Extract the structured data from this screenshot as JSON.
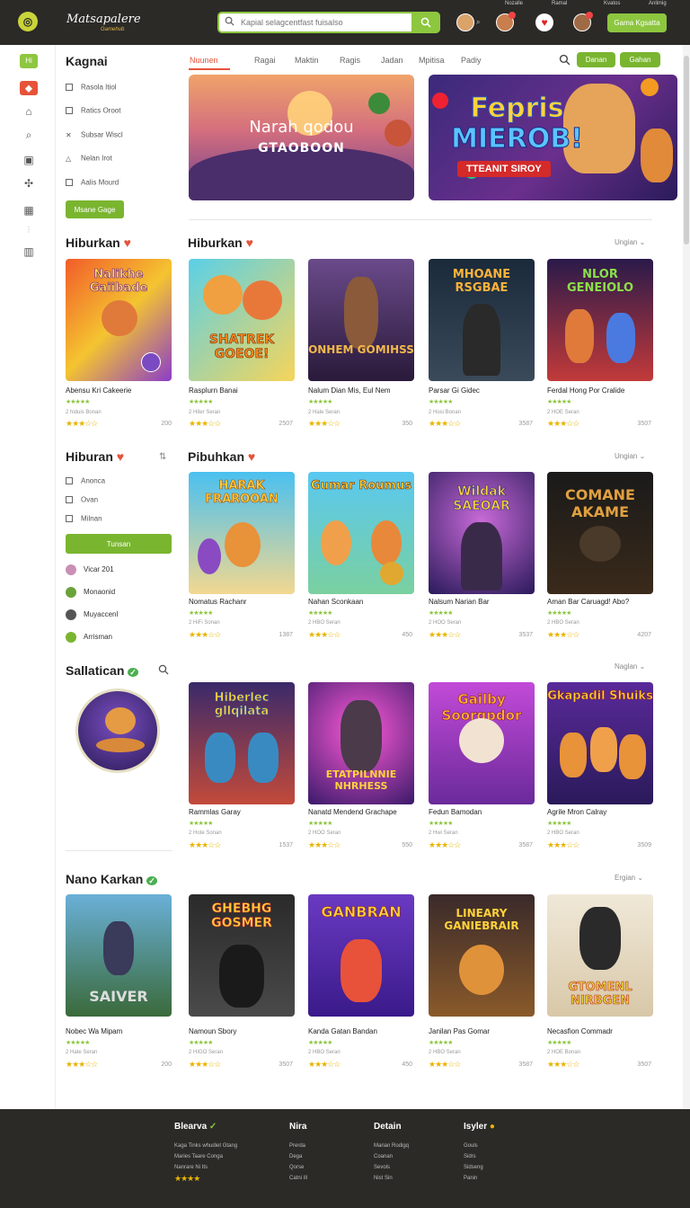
{
  "header": {
    "brand": "Matsapalere",
    "brand_sub": "Gamehub",
    "search_placeholder": "Kapial selagcentfast fuisalso",
    "top_strip": [
      "Nozalle",
      "Ramal",
      "Kvatos",
      "Anlimig"
    ],
    "cta": "Gama Kgsatta"
  },
  "rail": {
    "top_badge": "Hi"
  },
  "sidebar": {
    "title": "Kagnai",
    "filters": [
      "Rasola Itiol",
      "Ratics Oroot",
      "Subsar Wiscl",
      "Nelan Irot",
      "Aalis Mourd"
    ],
    "filters_button": "Msane Gage",
    "section2_title": "Hiburan",
    "section2_filters": [
      "Anonca",
      "Ovan",
      "Milnan"
    ],
    "section2_button": "Tunsan",
    "users": [
      "Vicar 201",
      "Monaonid",
      "Muyaccenl",
      "Arrisman"
    ],
    "section3_title": "Sallatican",
    "section4_title": "Nano Karkan"
  },
  "nav": {
    "tabs": [
      "Nuunen",
      "Ragai",
      "Maktin",
      "Ragis",
      "Jadan",
      "Mpitisa",
      "Padiy"
    ],
    "btn1": "Danan",
    "btn2": "Gahan"
  },
  "banners": {
    "left_title": "Narah qodou",
    "left_sub": "GTAOBOON",
    "right_title1": "Fepris",
    "right_title2": "MIEROB!",
    "right_sub": "TTEANIT SIROY"
  },
  "sections": [
    {
      "title": "Hiburkan",
      "more": "Ungian",
      "cards": [
        {
          "name": "Abensu Kri Cakeerie",
          "meta": "2 hiduis Bonan",
          "count": "200",
          "art": "Nalikhe Gaiibade"
        },
        {
          "name": "Rasplurn Banai",
          "meta": "2 Hiter Seran",
          "count": "2507",
          "art": "SHATREK GOEOE!"
        },
        {
          "name": "Nalum Dian Mis, Eul Nem",
          "meta": "2 Hale Seran",
          "count": "350",
          "art": "ONHEM GOMIHSS"
        },
        {
          "name": "Parsar Gi Gidec",
          "meta": "2 Hosi Bonan",
          "count": "3587",
          "art": "MHOANE RSGBAE"
        },
        {
          "name": "Ferdal Hong Por Cralide",
          "meta": "2 HOE Seran",
          "count": "3507",
          "art": "NLOR GENEIOLO"
        }
      ]
    },
    {
      "title": "Pibuhkan",
      "more": "Ungian",
      "cards": [
        {
          "name": "Nomatus Rachanr",
          "meta": "2 HiFi Sonan",
          "count": "1387",
          "art": "HARAK FRAROOAN"
        },
        {
          "name": "Nahan Sconkaan",
          "meta": "2 HBO Seran",
          "count": "450",
          "art": "Gumar Roumus"
        },
        {
          "name": "Nalsum Narian Bar",
          "meta": "2 HOO Seran",
          "count": "3537",
          "art": "Wildak SAEOAR"
        },
        {
          "name": "Aman Bar Caruagd! Abo?",
          "meta": "2 HBO Seran",
          "count": "4207",
          "art": "COMANE AKAME"
        }
      ]
    },
    {
      "title": "",
      "more": "Naglan",
      "cards": [
        {
          "name": "Rammlas Garay",
          "meta": "2 Hote Sonan",
          "count": "1537",
          "art": "Hiberlec gllqilata"
        },
        {
          "name": "Nanatd Mendend Grachape",
          "meta": "2 HOO Seran",
          "count": "550",
          "art": "ETATPILNNIE NHRHESS"
        },
        {
          "name": "Fedun Bamodan",
          "meta": "2 Hwi Seran",
          "count": "3587",
          "art": "Gailby Soorgpdor"
        },
        {
          "name": "Agrile Mron Calray",
          "meta": "2 HBO Seran",
          "count": "3509",
          "art": "Gkapadil Shuiks"
        }
      ]
    },
    {
      "title": "",
      "more": "Ergian",
      "cards": [
        {
          "name": "Nobec Wa Mipam",
          "meta": "2 Hate Seran",
          "count": "200",
          "art": "SAIVER"
        },
        {
          "name": "Namoun Sbory",
          "meta": "2 HIGO Seran",
          "count": "3507",
          "art": "GHEBHG GOSMER"
        },
        {
          "name": "Kanda Gatan Bandan",
          "meta": "2 HBO Seran",
          "count": "450",
          "art": "GANBRAN"
        },
        {
          "name": "Janilan Pas Gomar",
          "meta": "2 HBO Seran",
          "count": "3587",
          "art": "LINEARY GANIEBRAIR"
        },
        {
          "name": "Necasfion Commadr",
          "meta": "2 HOE Bonan",
          "count": "3507",
          "art": "GTOMENL NIRBGEN"
        }
      ]
    }
  ],
  "footer": {
    "col1_title": "Blearva",
    "col1_links": [
      "Kaga Tinks whudiet Gtang",
      "Maries Taare Conga",
      "Nanrare Ni Its"
    ],
    "col2_title": "Nira",
    "col2_links": [
      "Prerda",
      "Dega",
      "Qorse",
      "Catni Ill"
    ],
    "col3_title": "Detain",
    "col3_links": [
      "Marian Rodigq",
      "Coanan",
      "Sevols",
      "Nist Sin"
    ],
    "col4_title": "Isyler",
    "col4_links": [
      "Gouls",
      "Sidrs",
      "Sidseng",
      "Panin"
    ]
  },
  "colors": {
    "accent": "#8dc63f",
    "dark": "#2b2a27",
    "orange": "#e5533a"
  }
}
